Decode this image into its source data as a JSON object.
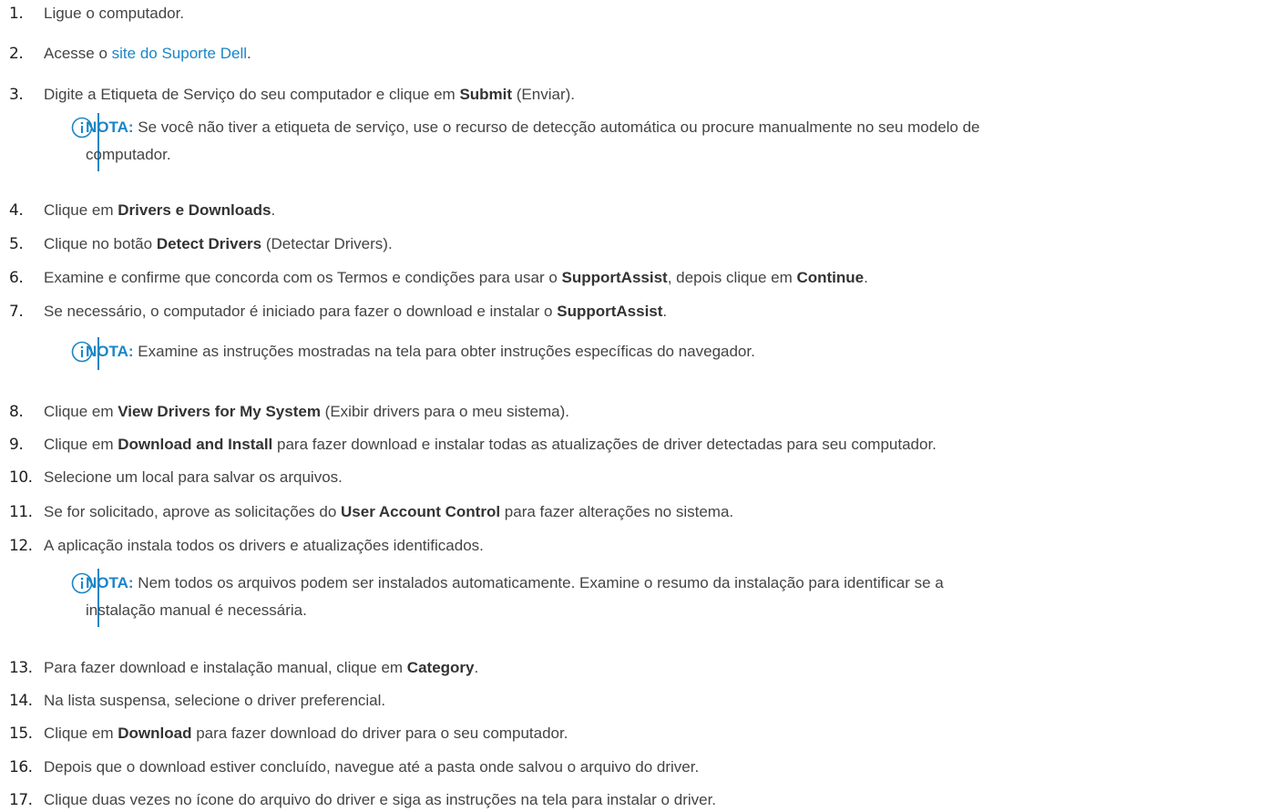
{
  "steps": [
    {
      "n": "1.",
      "text": "Ligue o computador."
    },
    {
      "n": "2.",
      "pre": "Acesse o ",
      "link": "site do Suporte Dell",
      "post": "."
    },
    {
      "n": "3.",
      "pre": "Digite a Etiqueta de Serviço do seu computador e clique em ",
      "b": "Submit",
      "post": " (Enviar)."
    },
    {
      "n": "4.",
      "pre": "Clique em ",
      "b": "Drivers e Downloads",
      "post": "."
    },
    {
      "n": "5.",
      "pre": "Clique no botão ",
      "b": "Detect Drivers",
      "post": " (Detectar Drivers)."
    },
    {
      "n": "6.",
      "pre": "Examine e confirme que concorda com os Termos e condições para usar o ",
      "b": "SupportAssist",
      "mid": ", depois clique em ",
      "b2": "Continue",
      "post": "."
    },
    {
      "n": "7.",
      "pre": "Se necessário, o computador é iniciado para fazer o download e instalar o ",
      "b": "SupportAssist",
      "post": "."
    },
    {
      "n": "8.",
      "pre": "Clique em ",
      "b": "View Drivers for My System",
      "post": " (Exibir drivers para o meu sistema)."
    },
    {
      "n": "9.",
      "pre": "Clique em ",
      "b": "Download and Install",
      "post": " para fazer download e instalar todas as atualizações de driver detectadas para seu computador."
    },
    {
      "n": "10.",
      "text": "Selecione um local para salvar os arquivos."
    },
    {
      "n": "11.",
      "pre": "Se for solicitado, aprove as solicitações do ",
      "b": "User Account Control",
      "post": " para fazer alterações no sistema."
    },
    {
      "n": "12.",
      "text": "A aplicação instala todos os drivers e atualizações identificados."
    },
    {
      "n": "13.",
      "pre": "Para fazer download e instalação manual, clique em ",
      "b": "Category",
      "post": "."
    },
    {
      "n": "14.",
      "text": "Na lista suspensa, selecione o driver preferencial."
    },
    {
      "n": "15.",
      "pre": "Clique em ",
      "b": "Download",
      "post": " para fazer download do driver para o seu computador."
    },
    {
      "n": "16.",
      "text": "Depois que o download estiver concluído, navegue até a pasta onde salvou o arquivo do driver."
    },
    {
      "n": "17.",
      "text": "Clique duas vezes no ícone do arquivo do driver e siga as instruções na tela para instalar o driver."
    }
  ],
  "notes": [
    {
      "label": "NOTA:",
      "line1": " Se você não tiver a etiqueta de serviço, use o recurso de detecção automática ou procure manualmente no seu modelo de",
      "line2": "computador."
    },
    {
      "label": "NOTA:",
      "line1": " Examine as instruções mostradas na tela para obter instruções específicas do navegador.",
      "line2": ""
    },
    {
      "label": "NOTA:",
      "line1": " Nem todos os arquivos podem ser instalados automaticamente. Examine o resumo da instalação para identificar se a",
      "line2": "instalação manual é necessária."
    }
  ],
  "icons": {
    "note": "info-circle-icon"
  },
  "colors": {
    "accent": "#1a85c8",
    "text": "#444444"
  }
}
